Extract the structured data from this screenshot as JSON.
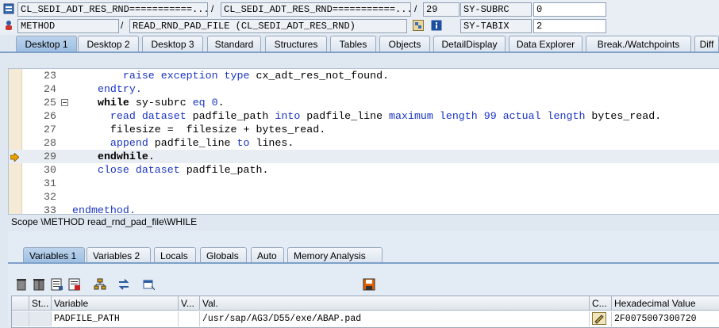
{
  "header": {
    "program_1": "CL_SEDI_ADT_RES_RND===========...",
    "program_2": "CL_SEDI_ADT_RES_RND===========...",
    "line_no": "29",
    "sy_subrc_label": "SY-SUBRC",
    "sy_subrc_value": "0",
    "event_type": "METHOD",
    "event_name": "READ_RND_PAD_FILE (CL_SEDI_ADT_RES_RND)",
    "sy_tabix_label": "SY-TABIX",
    "sy_tabix_value": "2",
    "sep": "/"
  },
  "tabs": [
    "Desktop 1",
    "Desktop 2",
    "Desktop 3",
    "Standard",
    "Structures",
    "Tables",
    "Objects",
    "DetailDisplay",
    "Data Explorer",
    "Break./Watchpoints",
    "Diff"
  ],
  "code": [
    {
      "ln": "23",
      "indent": "      ",
      "tokens": [
        [
          "kw",
          "raise exception type "
        ],
        [
          "t",
          "cx_adt_res_not_found."
        ]
      ]
    },
    {
      "ln": "24",
      "indent": "  ",
      "tokens": [
        [
          "kw",
          "endtry."
        ]
      ]
    },
    {
      "ln": "25",
      "indent": "  ",
      "tokens": [
        [
          "kwb",
          "while "
        ],
        [
          "t",
          "sy-subrc "
        ],
        [
          "kw",
          "eq "
        ],
        [
          "num",
          "0"
        ],
        [
          "t",
          "."
        ]
      ]
    },
    {
      "ln": "26",
      "indent": "    ",
      "tokens": [
        [
          "kw",
          "read dataset "
        ],
        [
          "t",
          "padfile_path "
        ],
        [
          "kw",
          "into "
        ],
        [
          "t",
          "padfile_line "
        ],
        [
          "kw",
          "maximum length "
        ],
        [
          "num",
          "99 "
        ],
        [
          "kw",
          "actual length "
        ],
        [
          "t",
          "bytes_read."
        ]
      ]
    },
    {
      "ln": "27",
      "indent": "    ",
      "tokens": [
        [
          "t",
          "filesize =  filesize + bytes_read."
        ]
      ]
    },
    {
      "ln": "28",
      "indent": "    ",
      "tokens": [
        [
          "kw",
          "append "
        ],
        [
          "t",
          "padfile_line "
        ],
        [
          "kw",
          "to "
        ],
        [
          "t",
          "lines."
        ]
      ]
    },
    {
      "ln": "29",
      "indent": "  ",
      "tokens": [
        [
          "kwb",
          "endwhile"
        ],
        [
          "t",
          "."
        ]
      ]
    },
    {
      "ln": "30",
      "indent": "  ",
      "tokens": [
        [
          "kw",
          "close dataset "
        ],
        [
          "t",
          "padfile_path."
        ]
      ]
    },
    {
      "ln": "31",
      "indent": "",
      "tokens": []
    },
    {
      "ln": "32",
      "indent": "",
      "tokens": []
    },
    {
      "ln": "33",
      "indent": "",
      "tokens": [
        [
          "kw",
          "endmethod."
        ]
      ]
    }
  ],
  "scope": "Scope \\METHOD read_rnd_pad_file\\WHILE",
  "var_tabs": [
    "Variables 1",
    "Variables 2",
    "Locals",
    "Globals",
    "Auto",
    "Memory Analysis"
  ],
  "grid": {
    "headers": [
      "St...",
      "Variable",
      "V...",
      "Val.",
      "C...",
      "Hexadecimal Value"
    ],
    "row": {
      "variable": "PADFILE_PATH",
      "value": "/usr/sap/AG3/D55/exe/ABAP.pad",
      "hex": "2F0075007300720"
    }
  },
  "colors": {
    "keyword": "#1a35c2",
    "active_tab": "#9dbfe3",
    "breakpoint_arrow": "#e8a100"
  }
}
